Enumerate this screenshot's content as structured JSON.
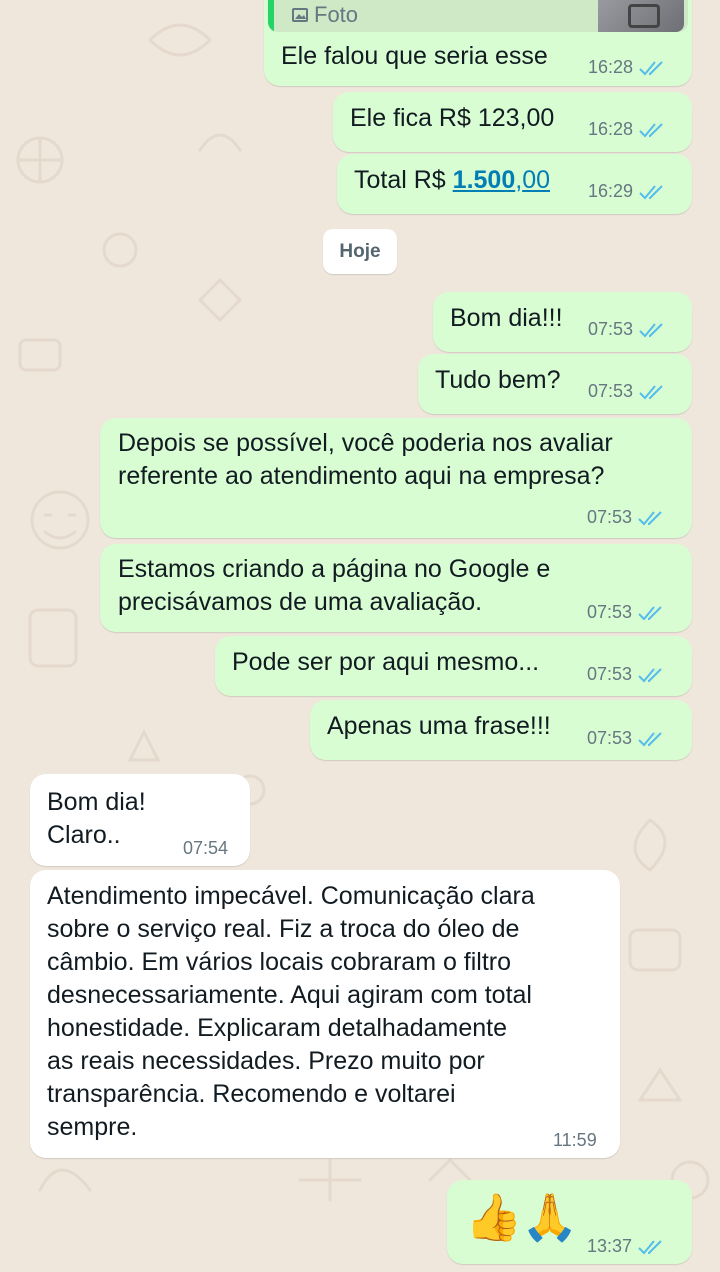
{
  "colors": {
    "wallpaper": "#efe7dc",
    "outgoing_bubble": "#d9fdd3",
    "incoming_bubble": "#ffffff",
    "read_ticks": "#53bdeb",
    "reply_bar": "#25d366"
  },
  "quoted_preview": {
    "label": "Foto",
    "icon": "photo-icon"
  },
  "date_separator": "Hoje",
  "messages": [
    {
      "text": "Ele falou que seria esse",
      "time": "16:28",
      "status": "read"
    },
    {
      "text": "Ele fica R$ 123,00",
      "time": "16:28",
      "status": "read"
    },
    {
      "text_prefix": "Total R$ ",
      "link_main": "1.500",
      "link_sep": ",",
      "link_decimals": "00",
      "time": "16:29",
      "status": "read"
    },
    {
      "text": "Bom dia!!!",
      "time": "07:53",
      "status": "read"
    },
    {
      "text": "Tudo bem?",
      "time": "07:53",
      "status": "read"
    },
    {
      "lines": [
        "Depois se possível, você poderia nos avaliar",
        "referente ao atendimento aqui na empresa?"
      ],
      "time": "07:53",
      "status": "read"
    },
    {
      "lines": [
        "Estamos criando a página no Google e",
        "precisávamos de  uma avaliação."
      ],
      "time": "07:53",
      "status": "read"
    },
    {
      "text": "Pode ser por aqui mesmo...",
      "time": "07:53",
      "status": "read"
    },
    {
      "text": "Apenas uma frase!!!",
      "time": "07:53",
      "status": "read"
    },
    {
      "lines": [
        "Bom dia!",
        "Claro.."
      ],
      "time": "07:54"
    },
    {
      "lines": [
        "Atendimento impecável. Comunicação clara",
        "sobre o serviço real. Fiz a troca do óleo de",
        "câmbio. Em vários locais cobraram o filtro",
        "desnecessariamente. Aqui agiram com total",
        "honestidade. Explicaram detalhadamente",
        "as reais necessidades. Prezo muito por",
        "transparência. Recomendo e voltarei",
        "sempre."
      ],
      "time": "11:59"
    },
    {
      "emoji": [
        "👍",
        "🙏"
      ],
      "time": "13:37",
      "status": "read"
    }
  ]
}
